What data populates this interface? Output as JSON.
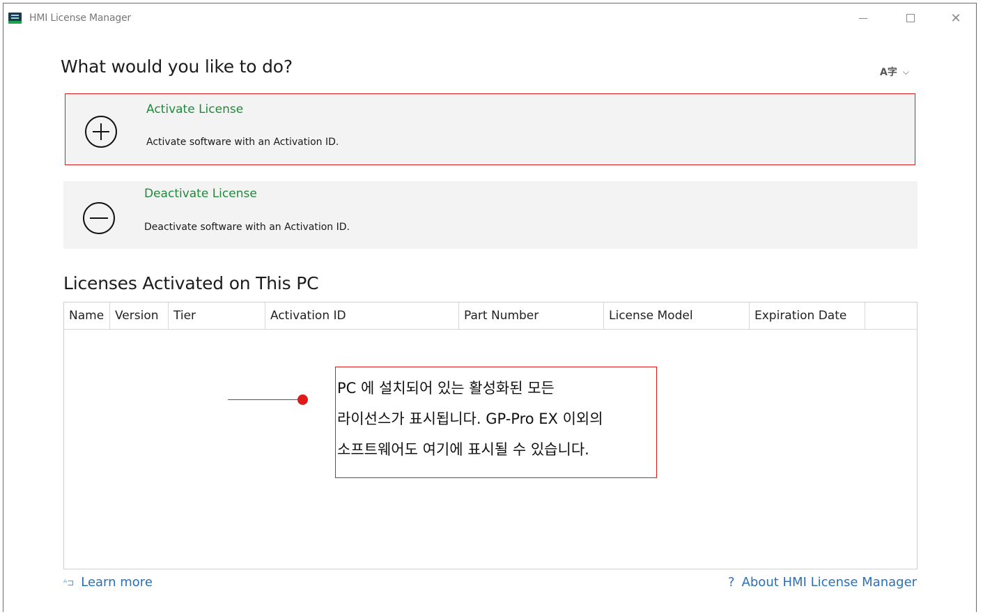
{
  "window": {
    "title": "HMI License Manager",
    "controls": {
      "minimize": "–",
      "maximize": "□",
      "close": "✕"
    }
  },
  "main": {
    "heading": "What would you like to do?",
    "language_icon": "A字",
    "language_chevron": "⌵",
    "actions": [
      {
        "icon": "plus-circle-icon",
        "title": "Activate License",
        "description": "Activate software with an Activation ID."
      },
      {
        "icon": "minus-circle-icon",
        "title": "Deactivate License",
        "description": "Deactivate software with an Activation ID."
      }
    ]
  },
  "licenses": {
    "heading": "Licenses Activated on This PC",
    "columns": [
      "Name",
      "Version",
      "Tier",
      "Activation ID",
      "Part Number",
      "License Model",
      "Expiration Date",
      ""
    ],
    "rows": []
  },
  "annotation": {
    "lines": [
      "PC 에 설치되어 있는 활성화된 모든",
      "라이선스가 표시됩니다. GP-Pro EX 이외의",
      "소프트웨어도 여기에 표시될 수 있습니다."
    ],
    "color": "#e01a1a"
  },
  "footer": {
    "learn_more_icon": "ᴬ⊐",
    "learn_more": "Learn more",
    "about_icon": "?",
    "about": "About HMI License Manager"
  },
  "colors": {
    "accent_green": "#1f8a3a",
    "link_blue": "#2a6fb8",
    "highlight_red": "#e01a1a"
  }
}
